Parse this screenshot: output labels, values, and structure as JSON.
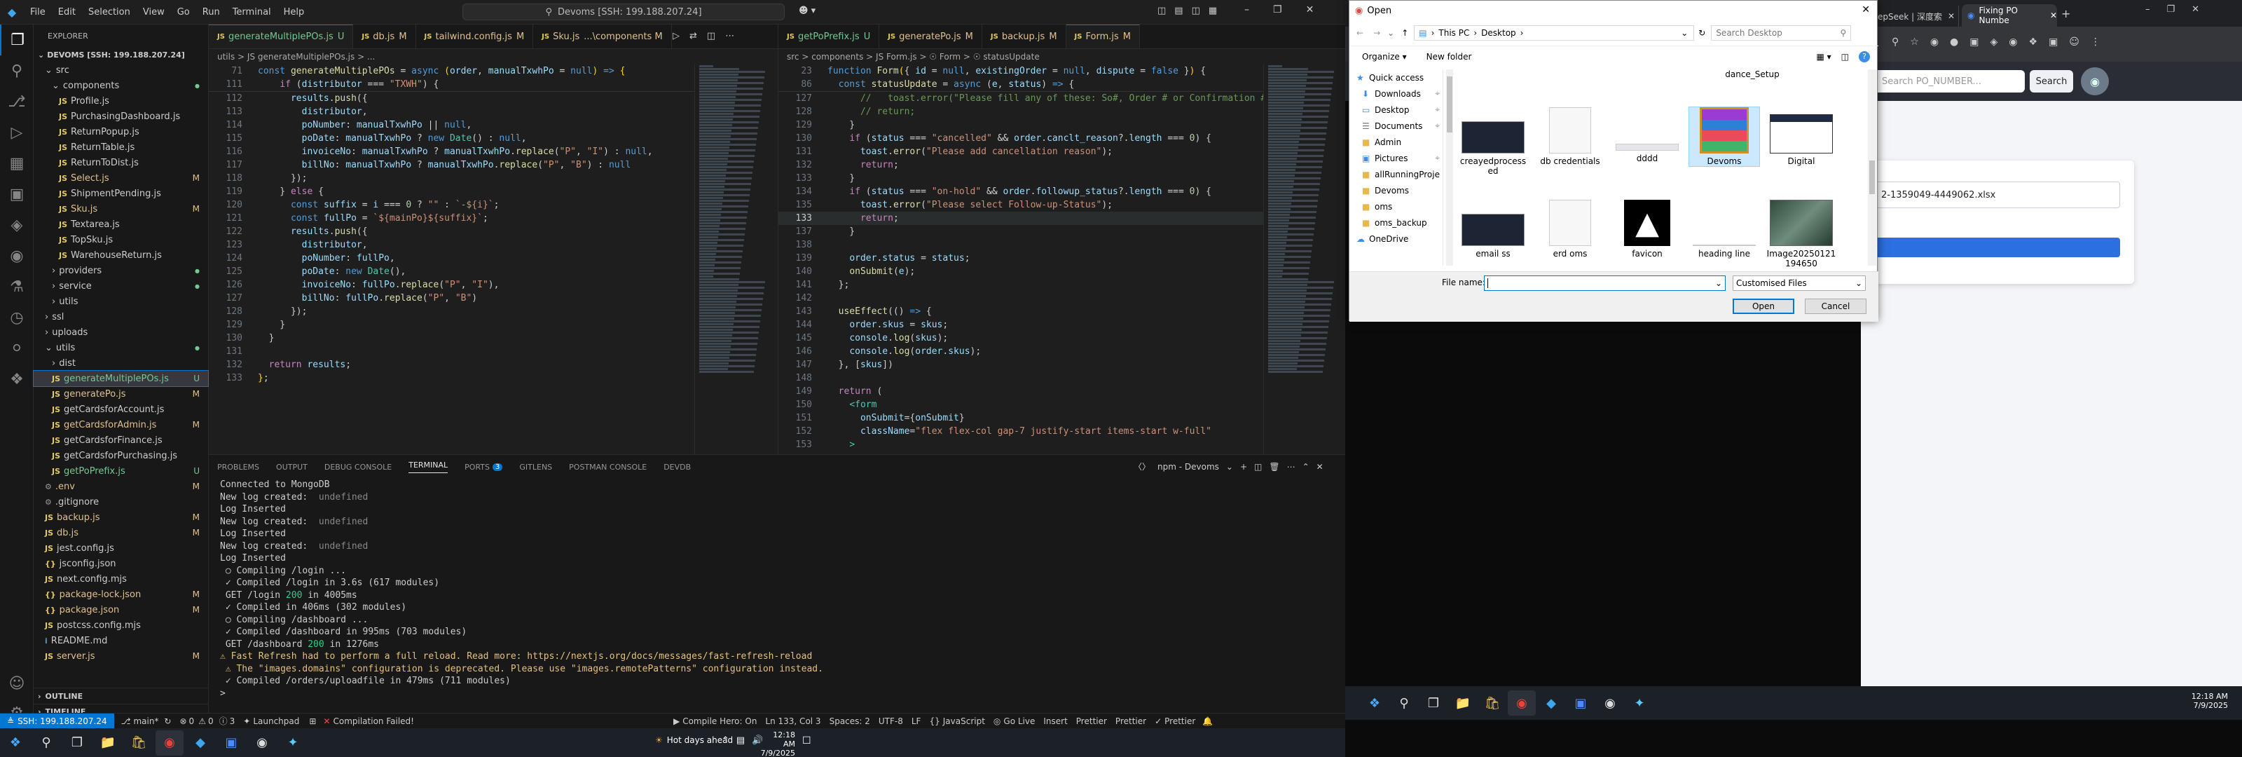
{
  "vscode": {
    "window_title": "Devoms [SSH: 199.188.207.24]",
    "menu": [
      "File",
      "Edit",
      "Selection",
      "View",
      "Go",
      "Run",
      "Terminal",
      "Help"
    ],
    "explorer_title": "EXPLORER",
    "root": "DEVOMS [SSH: 199.188.207.24]",
    "tree": [
      {
        "label": "src",
        "indent": 1,
        "type": "dir",
        "open": true,
        "status": ""
      },
      {
        "label": "components",
        "indent": 2,
        "type": "dir",
        "open": true,
        "status": "dot"
      },
      {
        "label": "Profile.js",
        "indent": 3,
        "type": "js",
        "status": ""
      },
      {
        "label": "PurchasingDashboard.js",
        "indent": 3,
        "type": "js",
        "status": ""
      },
      {
        "label": "ReturnPopup.js",
        "indent": 3,
        "type": "js",
        "status": ""
      },
      {
        "label": "ReturnTable.js",
        "indent": 3,
        "type": "js",
        "status": ""
      },
      {
        "label": "ReturnToDist.js",
        "indent": 3,
        "type": "js",
        "status": ""
      },
      {
        "label": "Select.js",
        "indent": 3,
        "type": "js",
        "status": "M"
      },
      {
        "label": "ShipmentPending.js",
        "indent": 3,
        "type": "js",
        "status": ""
      },
      {
        "label": "Sku.js",
        "indent": 3,
        "type": "js",
        "status": "M"
      },
      {
        "label": "Textarea.js",
        "indent": 3,
        "type": "js",
        "status": ""
      },
      {
        "label": "TopSku.js",
        "indent": 3,
        "type": "js",
        "status": ""
      },
      {
        "label": "WarehouseReturn.js",
        "indent": 3,
        "type": "js",
        "status": ""
      },
      {
        "label": "providers",
        "indent": 2,
        "type": "dir",
        "open": false,
        "status": "dot"
      },
      {
        "label": "service",
        "indent": 2,
        "type": "dir",
        "open": false,
        "status": "dot"
      },
      {
        "label": "utils",
        "indent": 2,
        "type": "dir",
        "open": false,
        "status": ""
      },
      {
        "label": "ssl",
        "indent": 1,
        "type": "dir",
        "open": false,
        "status": ""
      },
      {
        "label": "uploads",
        "indent": 1,
        "type": "dir",
        "open": false,
        "status": ""
      },
      {
        "label": "utils",
        "indent": 1,
        "type": "dir",
        "open": true,
        "status": "dot"
      },
      {
        "label": "dist",
        "indent": 2,
        "type": "dir",
        "open": false,
        "status": ""
      },
      {
        "label": "generateMultiplePOs.js",
        "indent": 2,
        "type": "js",
        "status": "U",
        "selected": true
      },
      {
        "label": "generatePo.js",
        "indent": 2,
        "type": "js",
        "status": "M"
      },
      {
        "label": "getCardsforAccount.js",
        "indent": 2,
        "type": "js",
        "status": ""
      },
      {
        "label": "getCardsforAdmin.js",
        "indent": 2,
        "type": "js",
        "status": "M"
      },
      {
        "label": "getCardsforFinance.js",
        "indent": 2,
        "type": "js",
        "status": ""
      },
      {
        "label": "getCardsforPurchasing.js",
        "indent": 2,
        "type": "js",
        "status": ""
      },
      {
        "label": "getPoPrefix.js",
        "indent": 2,
        "type": "js",
        "status": "U"
      },
      {
        "label": ".env",
        "indent": 1,
        "type": "file",
        "status": "M"
      },
      {
        "label": ".gitignore",
        "indent": 1,
        "type": "file",
        "status": ""
      },
      {
        "label": "backup.js",
        "indent": 1,
        "type": "js",
        "status": "M"
      },
      {
        "label": "db.js",
        "indent": 1,
        "type": "js",
        "status": "M"
      },
      {
        "label": "jest.config.js",
        "indent": 1,
        "type": "js",
        "status": ""
      },
      {
        "label": "jsconfig.json",
        "indent": 1,
        "type": "json",
        "status": ""
      },
      {
        "label": "next.config.mjs",
        "indent": 1,
        "type": "js",
        "status": ""
      },
      {
        "label": "package-lock.json",
        "indent": 1,
        "type": "json",
        "status": "M"
      },
      {
        "label": "package.json",
        "indent": 1,
        "type": "json",
        "status": "M"
      },
      {
        "label": "postcss.config.mjs",
        "indent": 1,
        "type": "js",
        "status": ""
      },
      {
        "label": "README.md",
        "indent": 1,
        "type": "md",
        "status": ""
      },
      {
        "label": "server.js",
        "indent": 1,
        "type": "js",
        "status": "M"
      }
    ],
    "outline": "OUTLINE",
    "timeline": "TIMELINE",
    "left_tabs": [
      {
        "label": "generateMultiplePOs.js",
        "status": "U",
        "active": true
      },
      {
        "label": "db.js",
        "status": "M"
      },
      {
        "label": "tailwind.config.js",
        "status": "M"
      },
      {
        "label": "Sku.js",
        "status": "...\\components M"
      }
    ],
    "right_tabs": [
      {
        "label": "getPoPrefix.js",
        "status": "U"
      },
      {
        "label": "generatePo.js",
        "status": "M"
      },
      {
        "label": "backup.js",
        "status": "M"
      },
      {
        "label": "Form.js",
        "status": "M",
        "active": true
      }
    ],
    "left_crumb": "utils > JS generateMultiplePOs.js > ...",
    "right_crumb": "src > components > JS Form.js > ☉ Form > ☉ statusUpdate",
    "left_code": [
      {
        "n": "71",
        "html": "<span class=kw>const</span> <span class=fn>generateMultiplePOs</span> <span class=pl>=</span> <span class=kw>async</span> <span class=br>(</span><span class=var>order</span>, <span class=var>manualTxwhPo</span> <span class=pl>=</span> <span class=kw>null</span><span class=br>)</span> <span class=kw>=&gt;</span> <span class=br>{</span>"
      },
      {
        "n": "111",
        "html": "    <span class=kw2>if</span> (<span class=var>distributor</span> <span class=pl>===</span> <span class=str>\"TXWH\"</span>) {"
      },
      {
        "n": "112",
        "html": "      <span class=var>results</span>.<span class=fn>push</span>({"
      },
      {
        "n": "113",
        "html": "        <span class=var>distributor</span>,"
      },
      {
        "n": "114",
        "html": "        <span class=var>poNumber</span>: <span class=var>manualTxwhPo</span> <span class=pl>||</span> <span class=kw>null</span>,"
      },
      {
        "n": "115",
        "html": "        <span class=var>poDate</span>: <span class=var>manualTxwhPo</span> ? <span class=kw>new</span> <span class=cls>Date</span>() : <span class=kw>null</span>,"
      },
      {
        "n": "116",
        "html": "        <span class=var>invoiceNo</span>: <span class=var>manualTxwhPo</span> ? <span class=var>manualTxwhPo</span>.<span class=fn>replace</span>(<span class=str>\"P\"</span>, <span class=str>\"I\"</span>) : <span class=kw>null</span>,"
      },
      {
        "n": "117",
        "html": "        <span class=var>billNo</span>: <span class=var>manualTxwhPo</span> ? <span class=var>manualTxwhPo</span>.<span class=fn>replace</span>(<span class=str>\"P\"</span>, <span class=str>\"B\"</span>) : <span class=kw>null</span>"
      },
      {
        "n": "118",
        "html": "      });"
      },
      {
        "n": "119",
        "html": "    } <span class=kw2>else</span> {"
      },
      {
        "n": "120",
        "html": "      <span class=kw>const</span> <span class=var>suffix</span> <span class=pl>=</span> <span class=var>i</span> <span class=pl>===</span> <span class=num>0</span> ? <span class=str>\"\"</span> : <span class=str>`-${i}`</span>;"
      },
      {
        "n": "121",
        "html": "      <span class=kw>const</span> <span class=var>fullPo</span> <span class=pl>=</span> <span class=str>`${mainPo}${suffix}`</span>;"
      },
      {
        "n": "122",
        "html": "      <span class=var>results</span>.<span class=fn>push</span>({"
      },
      {
        "n": "123",
        "html": "        <span class=var>distributor</span>,"
      },
      {
        "n": "124",
        "html": "        <span class=var>poNumber</span>: <span class=var>fullPo</span>,"
      },
      {
        "n": "125",
        "html": "        <span class=var>poDate</span>: <span class=kw>new</span> <span class=cls>Date</span>(),"
      },
      {
        "n": "126",
        "html": "        <span class=var>invoiceNo</span>: <span class=var>fullPo</span>.<span class=fn>replace</span>(<span class=str>\"P\"</span>, <span class=str>\"I\"</span>),"
      },
      {
        "n": "127",
        "html": "        <span class=var>billNo</span>: <span class=var>fullPo</span>.<span class=fn>replace</span>(<span class=str>\"P\"</span>, <span class=str>\"B\"</span>)"
      },
      {
        "n": "128",
        "html": "      });"
      },
      {
        "n": "129",
        "html": "    }"
      },
      {
        "n": "130",
        "html": "  }"
      },
      {
        "n": "131",
        "html": ""
      },
      {
        "n": "132",
        "html": "  <span class=kw2>return</span> <span class=var>results</span>;"
      },
      {
        "n": "133",
        "html": "<span class=br>}</span>;"
      }
    ],
    "right_code": [
      {
        "n": "23",
        "html": "<span class=kw>function</span> <span class=fn>Form</span><span class=br>(</span>{ <span class=var>id</span> <span class=pl>=</span> <span class=kw>null</span>, <span class=var>existingOrder</span> <span class=pl>=</span> <span class=kw>null</span>, <span class=var>dispute</span> <span class=pl>=</span> <span class=kw>false</span> }<span class=br>)</span> {"
      },
      {
        "n": "86",
        "html": "  <span class=kw>const</span> <span class=fn>statusUpdate</span> <span class=pl>=</span> <span class=kw>async</span> (<span class=var>e</span>, <span class=var>status</span>) <span class=kw>=&gt;</span> {"
      },
      {
        "n": "127",
        "html": "      <span class=cm>//   toast.error(\"Please fill any of these: So#, Order # or Confirmation #\")</span>"
      },
      {
        "n": "128",
        "html": "      <span class=cm>// return;</span>"
      },
      {
        "n": "129",
        "html": "    }"
      },
      {
        "n": "130",
        "html": "    <span class=kw2>if</span> (<span class=var>status</span> <span class=pl>===</span> <span class=str>\"cancelled\"</span> <span class=pl>&amp;&amp;</span> <span class=var>order</span>.<span class=var>canclt_reason</span>?.<span class=var>length</span> <span class=pl>===</span> <span class=num>0</span>) {"
      },
      {
        "n": "131",
        "html": "      <span class=var>toast</span>.<span class=fn>error</span>(<span class=str>\"Please add cancellation reason\"</span>);"
      },
      {
        "n": "132",
        "html": "      <span class=kw2>return</span>;"
      },
      {
        "n": "133",
        "html": "    }"
      },
      {
        "n": "134",
        "html": "    <span class=kw2>if</span> (<span class=var>status</span> <span class=pl>===</span> <span class=str>\"on-hold\"</span> <span class=pl>&amp;&amp;</span> <span class=var>order</span>.<span class=var>followup_status</span>?.<span class=var>length</span> <span class=pl>===</span> <span class=num>0</span>) {"
      },
      {
        "n": "135",
        "html": "      <span class=var>toast</span>.<span class=fn>error</span>(<span class=str>\"Please select Follow-up-Status\"</span>);"
      },
      {
        "n": "133",
        "html": "      <span class=kw2>return</span>;",
        "cur": true
      },
      {
        "n": "137",
        "html": "    }"
      },
      {
        "n": "138",
        "html": ""
      },
      {
        "n": "139",
        "html": "    <span class=var>order</span>.<span class=var>status</span> <span class=pl>=</span> <span class=var>status</span>;"
      },
      {
        "n": "140",
        "html": "    <span class=fn>onSubmit</span>(<span class=var>e</span>);"
      },
      {
        "n": "141",
        "html": "  };"
      },
      {
        "n": "142",
        "html": ""
      },
      {
        "n": "143",
        "html": "  <span class=fn>useEffect</span>(() <span class=kw>=&gt;</span> {"
      },
      {
        "n": "144",
        "html": "    <span class=var>order</span>.<span class=var>skus</span> <span class=pl>=</span> <span class=var>skus</span>;"
      },
      {
        "n": "145",
        "html": "    <span class=var>console</span>.<span class=fn>log</span>(<span class=var>skus</span>);"
      },
      {
        "n": "146",
        "html": "    <span class=var>console</span>.<span class=fn>log</span>(<span class=var>order</span>.<span class=var>skus</span>);"
      },
      {
        "n": "147",
        "html": "  }, [<span class=var>skus</span>])"
      },
      {
        "n": "148",
        "html": ""
      },
      {
        "n": "149",
        "html": "  <span class=kw2>return</span> ("
      },
      {
        "n": "150",
        "html": "    <span class=cls>&lt;form</span>"
      },
      {
        "n": "151",
        "html": "      <span class=var>onSubmit</span>={<span class=var>onSubmit</span>}"
      },
      {
        "n": "152",
        "html": "      <span class=var>className</span>=<span class=str>\"flex flex-col gap-7 justify-start items-start w-full\"</span>"
      },
      {
        "n": "153",
        "html": "    <span class=cls>&gt;</span>"
      }
    ],
    "panel_tabs": [
      "PROBLEMS",
      "OUTPUT",
      "DEBUG CONSOLE",
      "TERMINAL",
      "PORTS",
      "GITLENS",
      "POSTMAN CONSOLE",
      "DEVDB"
    ],
    "ports_badge": "3",
    "terminal_name": "npm - Devoms",
    "terminal_lines": [
      "Connected to MongoDB",
      "New log created:  undefined",
      "Log Inserted",
      "New log created:  undefined",
      "Log Inserted",
      "New log created:  undefined",
      "Log Inserted",
      " ○ Compiling /login ...",
      " ✓ Compiled /login in 3.6s (617 modules)",
      " GET /login 200 in 4005ms",
      " ✓ Compiled in 406ms (302 modules)",
      " ○ Compiling /dashboard ...",
      " ✓ Compiled /dashboard in 995ms (703 modules)",
      " GET /dashboard 200 in 1276ms",
      "⚠ Fast Refresh had to perform a full reload. Read more: https://nextjs.org/docs/messages/fast-refresh-reload",
      " ⚠ The \"images.domains\" configuration is deprecated. Please use \"images.remotePatterns\" configuration instead.",
      " ✓ Compiled /orders/uploadfile in 479ms (711 modules)",
      ">"
    ],
    "status": {
      "remote": "SSH: 199.188.207.24",
      "branch": "main*",
      "sync": "↻",
      "errors": "0",
      "warnings": "0",
      "info": "3",
      "launchpad": "Launchpad",
      "build": "Compilation Failed!",
      "compile_hero": "Compile Hero: On",
      "position": "Ln 133, Col 3",
      "spaces": "Spaces: 2",
      "encoding": "UTF-8",
      "eol": "LF",
      "language": "JavaScript",
      "golive": "Go Live",
      "insert": "Insert",
      "prettier1": "Prettier",
      "prettier2": "Prettier",
      "prettier3": "Prettier"
    }
  },
  "taskbar_left": {
    "weather": "Hot days ahead",
    "time": "12:18 AM",
    "date": "7/9/2025"
  },
  "dialog": {
    "title": "Open",
    "path": [
      "This PC",
      "Desktop"
    ],
    "search_placeholder": "Search Desktop",
    "organize": "Organize ▾",
    "new_folder": "New folder",
    "nav_items": [
      {
        "label": "Quick access",
        "type": "star"
      },
      {
        "label": "Downloads",
        "type": "dl"
      },
      {
        "label": "Desktop",
        "type": "desk"
      },
      {
        "label": "Documents",
        "type": "doc"
      },
      {
        "label": "Admin",
        "type": "folder"
      },
      {
        "label": "Pictures",
        "type": "pic"
      },
      {
        "label": "allRunningProje",
        "type": "folder"
      },
      {
        "label": "Devoms",
        "type": "folder"
      },
      {
        "label": "oms",
        "type": "folder"
      },
      {
        "label": "oms_backup",
        "type": "folder"
      },
      {
        "label": "OneDrive",
        "type": "cloud"
      }
    ],
    "files": [
      {
        "label": "dance_Setup",
        "kind": "partial"
      },
      {
        "label": "creayedprocessed",
        "kind": "dark"
      },
      {
        "label": "db credentials",
        "kind": "doc"
      },
      {
        "label": "dddd",
        "kind": "light"
      },
      {
        "label": "Devoms",
        "kind": "rar"
      },
      {
        "label": "Digital",
        "kind": "screen"
      },
      {
        "label": "email ss",
        "kind": "dark"
      },
      {
        "label": "erd oms",
        "kind": "doc"
      },
      {
        "label": "favicon",
        "kind": "favicon"
      },
      {
        "label": "heading line",
        "kind": "line"
      },
      {
        "label": "Image20250121194650",
        "kind": "photo"
      }
    ],
    "filename_label": "File name:",
    "filename_value": "",
    "filter": "Customised Files",
    "open_btn": "Open",
    "cancel_btn": "Cancel"
  },
  "right_screen": {
    "tabs": [
      {
        "label": "epSeek | 深度索"
      },
      {
        "label": "Fixing PO Numbe",
        "active": true
      }
    ],
    "search_placeholder": "Search PO_NUMBER...",
    "search_btn": "Search",
    "upload_file": "2-1359049-4449062.xlsx",
    "time": "12:18 AM",
    "date": "7/9/2025"
  }
}
